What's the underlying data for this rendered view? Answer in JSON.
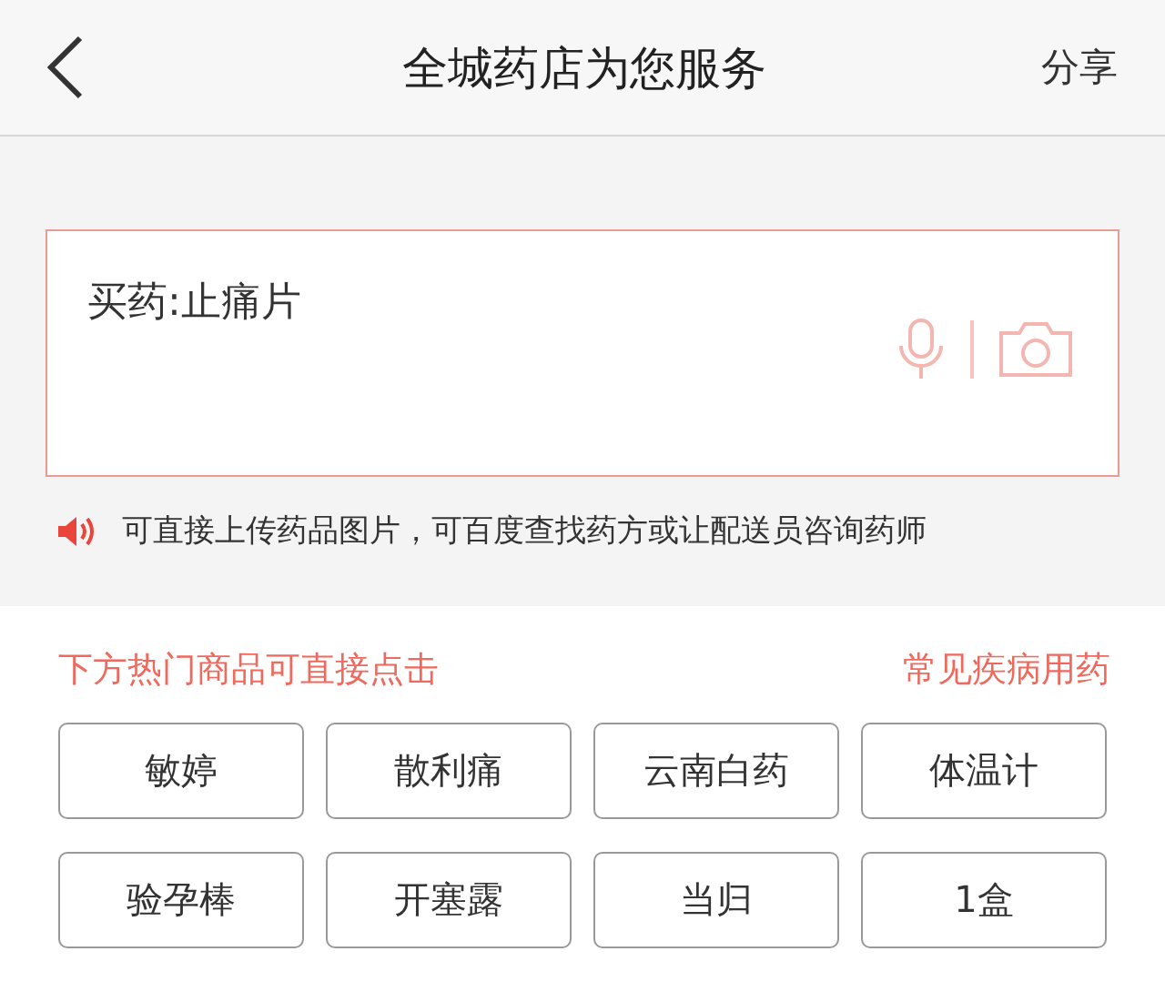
{
  "header": {
    "title": "全城药店为您服务",
    "share": "分享"
  },
  "search": {
    "value": "买药:止痛片"
  },
  "notice": "可直接上传药品图片，可百度查找药方或让配送员咨询药师",
  "hot": {
    "hint": "下方热门商品可直接点击",
    "link": "常见疾病用药",
    "items": [
      "敏婷",
      "散利痛",
      "云南白药",
      "体温计",
      "验孕棒",
      "开塞露",
      "当归",
      "1盒"
    ]
  }
}
